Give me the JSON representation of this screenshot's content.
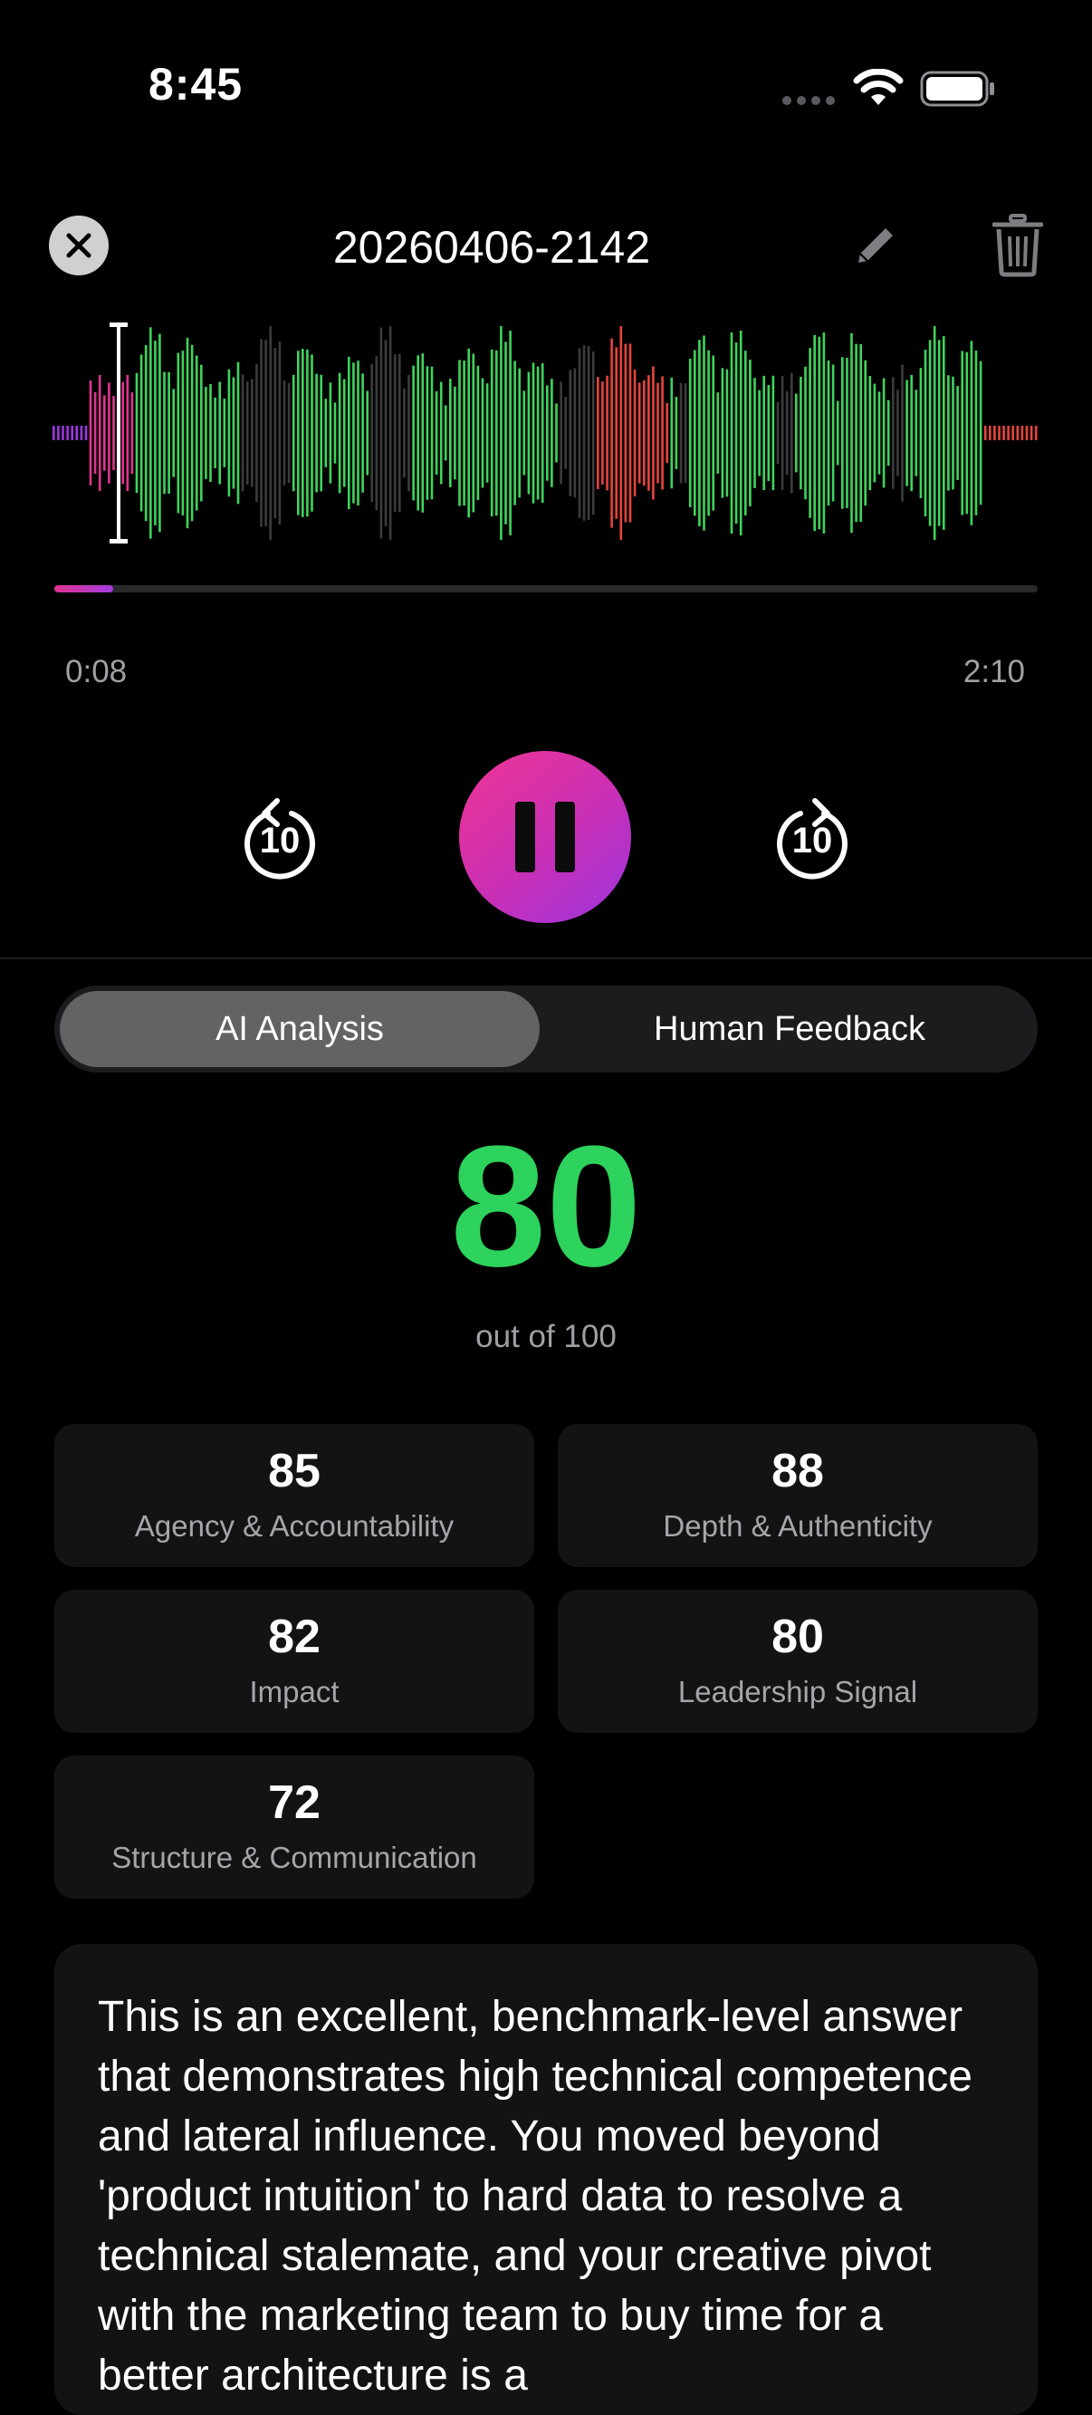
{
  "status_bar": {
    "time": "8:45",
    "icons": [
      "cellular-signal-icon",
      "wifi-icon",
      "battery-icon"
    ]
  },
  "header": {
    "title": "20260406-2142",
    "close_icon": "close-icon",
    "edit_icon": "pencil-icon",
    "delete_icon": "trash-icon"
  },
  "player": {
    "current_time": "0:08",
    "total_time": "2:10",
    "progress_fraction": 0.06,
    "skip_back_label": "10",
    "skip_forward_label": "10",
    "state_icon": "pause-icon"
  },
  "colors": {
    "background": "#000000",
    "score_green": "#2dd35c",
    "waveform_green": "#3ed45c",
    "waveform_red": "#e5443d",
    "waveform_grey": "#3c3c3e",
    "accent_pink": "#e0348f",
    "accent_purple": "#9b36e0",
    "card_bg": "#131314"
  },
  "tabs": {
    "items": [
      {
        "label": "AI Analysis",
        "active": true
      },
      {
        "label": "Human Feedback",
        "active": false
      }
    ]
  },
  "score": {
    "value": "80",
    "subtitle": "out of 100"
  },
  "metrics": [
    {
      "value": "85",
      "label": "Agency & Accountability"
    },
    {
      "value": "88",
      "label": "Depth & Authenticity"
    },
    {
      "value": "82",
      "label": "Impact"
    },
    {
      "value": "80",
      "label": "Leadership Signal"
    },
    {
      "value": "72",
      "label": "Structure & Communication"
    }
  ],
  "summary": {
    "text": "This is an excellent, benchmark-level answer that demonstrates high technical competence and lateral influence. You moved beyond 'product intuition' to hard data to resolve a technical stalemate, and your creative pivot with the marketing team to buy time for a better architecture is a"
  }
}
